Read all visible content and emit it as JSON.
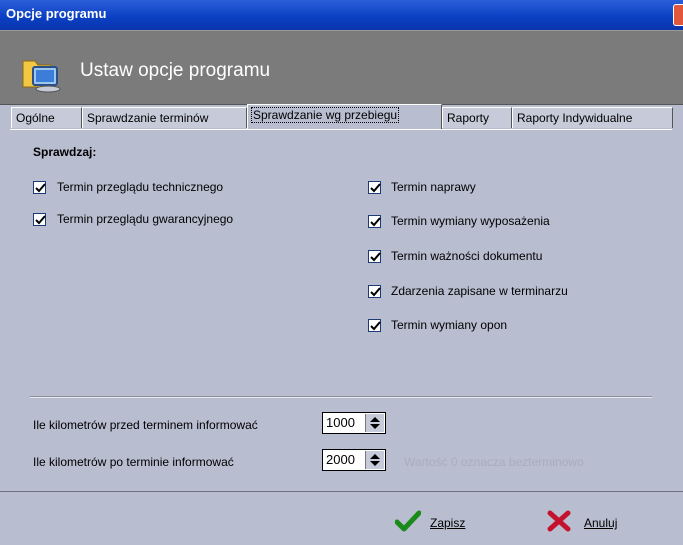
{
  "window": {
    "title": "Opcje programu"
  },
  "header": {
    "title": "Ustaw opcje programu",
    "icon": "monitor-folder-icon"
  },
  "tabs": [
    {
      "label": "Ogólne"
    },
    {
      "label": "Sprawdzanie terminów"
    },
    {
      "label": "Sprawdzanie wg przebiegu",
      "active": true
    },
    {
      "label": "Raporty"
    },
    {
      "label": "Raporty Indywidualne"
    }
  ],
  "section": {
    "title": "Sprawdzaj:"
  },
  "checkboxes_left": [
    {
      "label": "Termin przeglądu technicznego",
      "checked": true
    },
    {
      "label": "Termin przeglądu gwarancyjnego",
      "checked": true
    }
  ],
  "checkboxes_right": [
    {
      "label": "Termin naprawy",
      "checked": true
    },
    {
      "label": "Termin wymiany wyposażenia",
      "checked": true
    },
    {
      "label": "Termin ważności dokumentu",
      "checked": true
    },
    {
      "label": "Zdarzenia zapisane w terminarzu",
      "checked": true
    },
    {
      "label": "Termin wymiany opon",
      "checked": true
    }
  ],
  "km_before": {
    "label": "Ile kilometrów przed terminem informować",
    "value": "1000"
  },
  "km_after": {
    "label": "Ile kilometrów po terminie informować",
    "value": "2000"
  },
  "hint": "Wartość 0 oznacza bezterminowo",
  "buttons": {
    "save": "Zapisz",
    "cancel": "Anuluj"
  },
  "colors": {
    "titlebar": "#0a3ec2",
    "header": "#7b7b7b",
    "body": "#b9bdd0",
    "check": "#1c3b72"
  }
}
